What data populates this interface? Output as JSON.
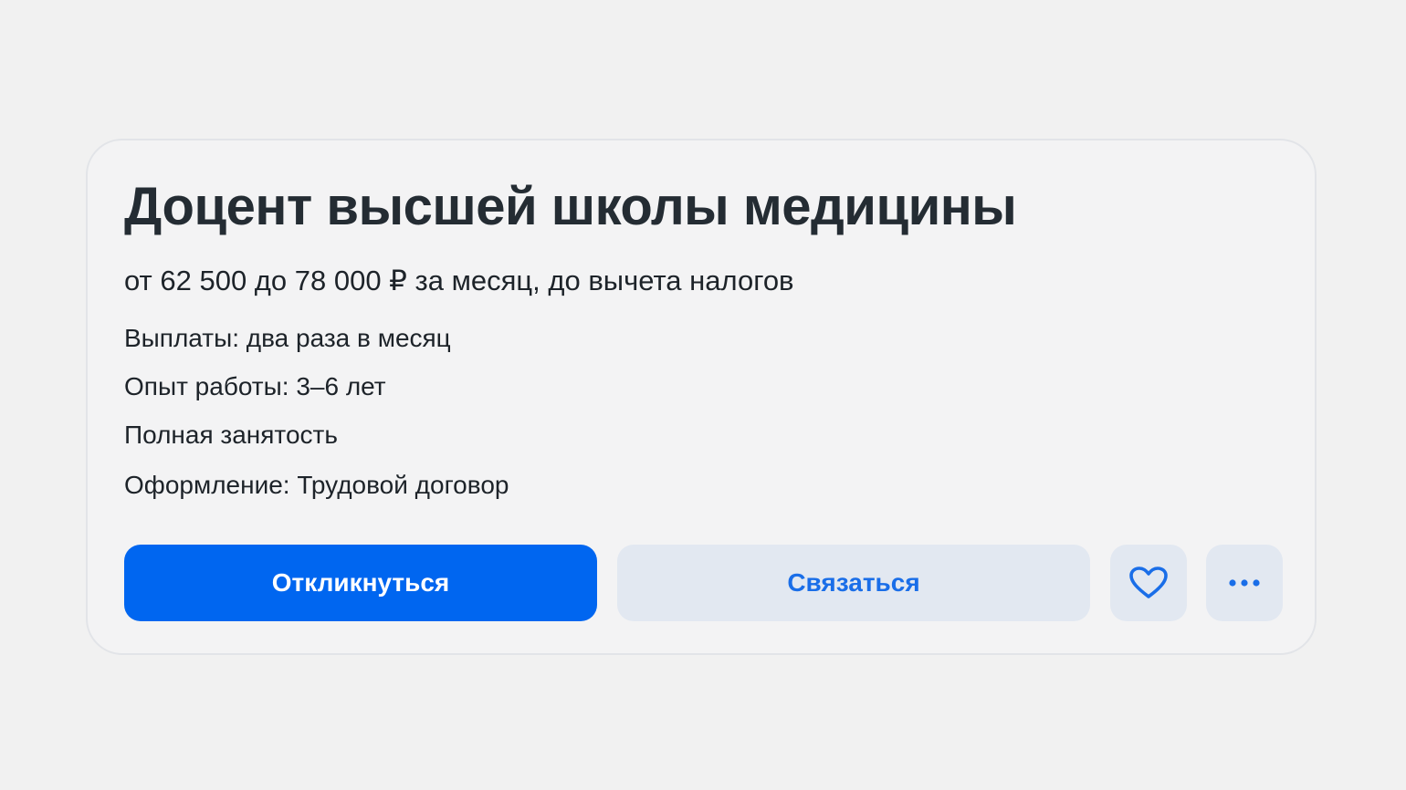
{
  "vacancy": {
    "title": "Доцент высшей школы медицины",
    "salary": "от 62 500 до 78 000 ₽ за месяц, до вычета налогов",
    "details": [
      "Выплаты: два раза в месяц",
      "Опыт работы: 3–6 лет",
      "Полная занятость",
      "Оформление: Трудовой договор"
    ]
  },
  "actions": {
    "respond_label": "Откликнуться",
    "contact_label": "Связаться",
    "favorite_icon": "heart-icon",
    "more_icon": "more-horizontal-icon"
  },
  "colors": {
    "page_background": "#f1f1f1",
    "primary": "#0066f0",
    "secondary_bg": "#e2e8f1",
    "secondary_text": "#1a6ee8",
    "title_text": "#242c33"
  }
}
